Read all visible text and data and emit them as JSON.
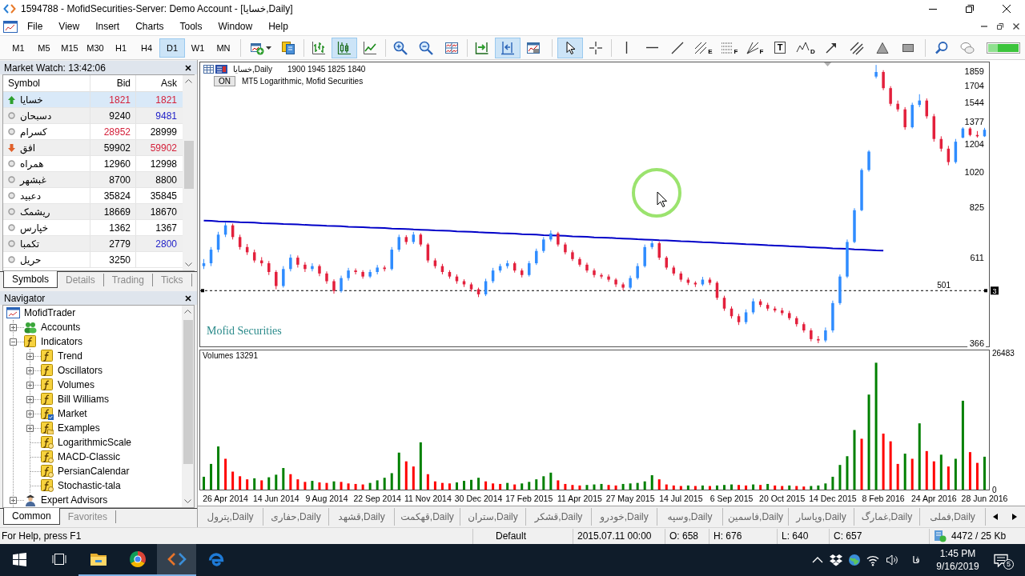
{
  "window": {
    "title": "1594788 - MofidSecurities-Server: Demo Account - [خسایا,Daily]"
  },
  "menu": [
    "File",
    "View",
    "Insert",
    "Charts",
    "Tools",
    "Window",
    "Help"
  ],
  "toolbar": {
    "timeframes": [
      {
        "label": "M1",
        "selected": false
      },
      {
        "label": "M5",
        "selected": false
      },
      {
        "label": "M15",
        "selected": false
      },
      {
        "label": "M30",
        "selected": false
      },
      {
        "label": "H1",
        "selected": false
      },
      {
        "label": "H4",
        "selected": false
      },
      {
        "label": "D1",
        "selected": true
      },
      {
        "label": "W1",
        "selected": false
      },
      {
        "label": "MN",
        "selected": false
      }
    ],
    "tools": [
      {
        "selected": false
      },
      {
        "selected": false
      },
      {
        "selected": false
      },
      {
        "selected": true
      },
      {
        "selected": false
      },
      {
        "selected": false
      },
      {
        "selected": false
      },
      {
        "selected": false
      },
      {
        "selected": false
      },
      {
        "selected": true
      },
      {
        "selected": false
      },
      {
        "selected": true
      },
      {
        "selected": false
      },
      {
        "selected": false
      },
      {
        "selected": false
      },
      {
        "selected": false
      },
      {
        "selected": false,
        "letter": "E"
      },
      {
        "selected": false,
        "letter": "F"
      },
      {
        "selected": false,
        "letter": "F"
      },
      {
        "selected": false,
        "letter": "T"
      },
      {
        "selected": false,
        "letter": "D"
      },
      {
        "selected": false
      },
      {
        "selected": false
      },
      {
        "selected": false
      },
      {
        "selected": false
      },
      {
        "selected": false
      },
      {
        "selected": false
      }
    ]
  },
  "market_watch": {
    "title": "Market Watch: 13:42:06",
    "columns": [
      "Symbol",
      "Bid",
      "Ask"
    ],
    "rows": [
      {
        "symbol": "خسایا",
        "kind": "up",
        "bid": {
          "label": "1821",
          "color": "#d4203a"
        },
        "ask": {
          "label": "1821",
          "color": "#d4203a"
        },
        "selected": true
      },
      {
        "symbol": "دسبحان",
        "kind": "flat",
        "bid": {
          "label": "9240",
          "color": "#000000"
        },
        "ask": {
          "label": "9481",
          "color": "#2323c8"
        },
        "selected": false
      },
      {
        "symbol": "کسرام",
        "kind": "flat",
        "bid": {
          "label": "28952",
          "color": "#d4203a"
        },
        "ask": {
          "label": "28999",
          "color": "#000000"
        },
        "selected": false
      },
      {
        "symbol": "افق",
        "kind": "down",
        "bid": {
          "label": "59902",
          "color": "#000000"
        },
        "ask": {
          "label": "59902",
          "color": "#d4203a"
        },
        "selected": false
      },
      {
        "symbol": "همراه",
        "kind": "flat",
        "bid": {
          "label": "12960",
          "color": "#000000"
        },
        "ask": {
          "label": "12998",
          "color": "#000000"
        },
        "selected": false
      },
      {
        "symbol": "غبشهر",
        "kind": "flat",
        "bid": {
          "label": "8700",
          "color": "#000000"
        },
        "ask": {
          "label": "8800",
          "color": "#000000"
        },
        "selected": false
      },
      {
        "symbol": "دعبید",
        "kind": "flat",
        "bid": {
          "label": "35824",
          "color": "#000000"
        },
        "ask": {
          "label": "35845",
          "color": "#000000"
        },
        "selected": false
      },
      {
        "symbol": "ریشمک",
        "kind": "flat",
        "bid": {
          "label": "18669",
          "color": "#000000"
        },
        "ask": {
          "label": "18670",
          "color": "#000000"
        },
        "selected": false
      },
      {
        "symbol": "خپارس",
        "kind": "flat",
        "bid": {
          "label": "1362",
          "color": "#000000"
        },
        "ask": {
          "label": "1367",
          "color": "#000000"
        },
        "selected": false
      },
      {
        "symbol": "تکمبا",
        "kind": "flat",
        "bid": {
          "label": "2779",
          "color": "#000000"
        },
        "ask": {
          "label": "2800",
          "color": "#2323c8"
        },
        "selected": false
      },
      {
        "symbol": "حریل",
        "kind": "flat",
        "bid": {
          "label": "3250",
          "color": "#000000"
        },
        "selected": false
      }
    ],
    "tabs": [
      {
        "label": "Symbols",
        "selected": true
      },
      {
        "label": "Details",
        "selected": false
      },
      {
        "label": "Trading",
        "selected": false
      },
      {
        "label": "Ticks",
        "selected": false
      }
    ]
  },
  "navigator": {
    "title": "Navigator",
    "tree": [
      {
        "label": "MofidTrader",
        "kind": "root",
        "children": [
          {
            "label": "Accounts",
            "kind": "accounts",
            "expanded": false
          },
          {
            "label": "Indicators",
            "kind": "folder",
            "expanded": true,
            "children": [
              {
                "label": "Trend",
                "kind": "folder",
                "expanded": false
              },
              {
                "label": "Oscillators",
                "kind": "folder",
                "expanded": false
              },
              {
                "label": "Volumes",
                "kind": "folder",
                "expanded": false
              },
              {
                "label": "Bill Williams",
                "kind": "folder",
                "expanded": false
              },
              {
                "label": "Market",
                "kind": "market",
                "expanded": false
              },
              {
                "label": "Examples",
                "kind": "examples",
                "expanded": false
              },
              {
                "label": "LogarithmicScale",
                "kind": "indicator"
              },
              {
                "label": "MACD-Classic",
                "kind": "indicator"
              },
              {
                "label": "PersianCalendar",
                "kind": "indicator"
              },
              {
                "label": "Stochastic-tala",
                "kind": "indicator"
              }
            ]
          },
          {
            "label": "Expert Advisors",
            "kind": "experts",
            "expanded": false
          }
        ]
      }
    ],
    "tabs": [
      {
        "label": "Common",
        "selected": true
      },
      {
        "label": "Favorites",
        "selected": false
      }
    ]
  },
  "chart": {
    "header": {
      "symbol_period": "خسایا,Daily",
      "ohlc": "1900 1945 1825 1840"
    },
    "indicator": {
      "button": "ON",
      "label": "MT5 Logarithmic, Mofid Securities"
    },
    "logo_text": "Mofid Securities",
    "chart_data": [
      {
        "type": "candlestick",
        "log": true,
        "ylim": [
          359,
          1950
        ],
        "yticks": [
          366,
          611,
          825,
          1020,
          1204,
          1377,
          1544,
          1704,
          1859
        ],
        "tick_labels": "y",
        "ohlc": [
          [
            580,
            605,
            570,
            590
          ],
          [
            590,
            650,
            580,
            640
          ],
          [
            640,
            712,
            630,
            700
          ],
          [
            700,
            752,
            690,
            740
          ],
          [
            740,
            748,
            680,
            690
          ],
          [
            690,
            700,
            640,
            650
          ],
          [
            650,
            662,
            620,
            630
          ],
          [
            630,
            640,
            592,
            600
          ],
          [
            600,
            612,
            580,
            590
          ],
          [
            590,
            598,
            550,
            560
          ],
          [
            560,
            566,
            505,
            515
          ],
          [
            515,
            580,
            510,
            570
          ],
          [
            570,
            622,
            562,
            610
          ],
          [
            610,
            618,
            575,
            585
          ],
          [
            585,
            594,
            560,
            570
          ],
          [
            570,
            590,
            562,
            580
          ],
          [
            580,
            586,
            546,
            555
          ],
          [
            555,
            562,
            522,
            530
          ],
          [
            530,
            536,
            492,
            500
          ],
          [
            500,
            548,
            495,
            540
          ],
          [
            540,
            574,
            532,
            565
          ],
          [
            565,
            572,
            552,
            560
          ],
          [
            560,
            566,
            538,
            545
          ],
          [
            545,
            568,
            540,
            560
          ],
          [
            560,
            584,
            552,
            575
          ],
          [
            575,
            582,
            562,
            570
          ],
          [
            570,
            650,
            565,
            640
          ],
          [
            640,
            700,
            632,
            690
          ],
          [
            690,
            698,
            660,
            670
          ],
          [
            670,
            712,
            662,
            700
          ],
          [
            700,
            706,
            652,
            660
          ],
          [
            660,
            666,
            592,
            600
          ],
          [
            600,
            608,
            572,
            580
          ],
          [
            580,
            588,
            552,
            560
          ],
          [
            560,
            566,
            538,
            545
          ],
          [
            545,
            552,
            522,
            530
          ],
          [
            530,
            536,
            512,
            520
          ],
          [
            520,
            526,
            498,
            505
          ],
          [
            505,
            510,
            482,
            490
          ],
          [
            490,
            538,
            485,
            530
          ],
          [
            530,
            574,
            524,
            565
          ],
          [
            565,
            588,
            558,
            580
          ],
          [
            580,
            600,
            572,
            590
          ],
          [
            590,
            596,
            558,
            565
          ],
          [
            565,
            572,
            542,
            550
          ],
          [
            550,
            598,
            545,
            590
          ],
          [
            590,
            644,
            584,
            635
          ],
          [
            635,
            690,
            628,
            680
          ],
          [
            680,
            718,
            672,
            705
          ],
          [
            705,
            712,
            652,
            660
          ],
          [
            660,
            668,
            622,
            630
          ],
          [
            630,
            638,
            598,
            605
          ],
          [
            605,
            612,
            578,
            585
          ],
          [
            585,
            592,
            558,
            565
          ],
          [
            565,
            572,
            542,
            550
          ],
          [
            550,
            556,
            538,
            545
          ],
          [
            545,
            552,
            528,
            535
          ],
          [
            535,
            540,
            512,
            520
          ],
          [
            520,
            526,
            502,
            510
          ],
          [
            510,
            548,
            505,
            540
          ],
          [
            540,
            590,
            535,
            580
          ],
          [
            580,
            660,
            575,
            650
          ],
          [
            650,
            678,
            642,
            665
          ],
          [
            665,
            672,
            602,
            610
          ],
          [
            610,
            616,
            568,
            575
          ],
          [
            575,
            582,
            548,
            555
          ],
          [
            555,
            562,
            528,
            535
          ],
          [
            535,
            542,
            518,
            525
          ],
          [
            525,
            530,
            512,
            520
          ],
          [
            520,
            544,
            515,
            535
          ],
          [
            535,
            542,
            518,
            525
          ],
          [
            525,
            530,
            474,
            480
          ],
          [
            480,
            486,
            444,
            450
          ],
          [
            450,
            456,
            424,
            430
          ],
          [
            430,
            436,
            408,
            415
          ],
          [
            415,
            448,
            410,
            440
          ],
          [
            440,
            478,
            435,
            470
          ],
          [
            470,
            476,
            454,
            460
          ],
          [
            460,
            466,
            444,
            450
          ],
          [
            450,
            456,
            440,
            445
          ],
          [
            445,
            452,
            432,
            438
          ],
          [
            438,
            444,
            420,
            425
          ],
          [
            425,
            430,
            404,
            410
          ],
          [
            410,
            415,
            390,
            395
          ],
          [
            395,
            400,
            370,
            375
          ],
          [
            375,
            382,
            366,
            372
          ],
          [
            372,
            402,
            368,
            395
          ],
          [
            395,
            472,
            390,
            465
          ],
          [
            465,
            552,
            460,
            545
          ],
          [
            545,
            680,
            540,
            670
          ],
          [
            670,
            820,
            665,
            810
          ],
          [
            810,
            1040,
            805,
            1030
          ],
          [
            1030,
            1160,
            1020,
            1150
          ],
          [
            1800,
            1930,
            1780,
            1850
          ],
          [
            1850,
            1870,
            1660,
            1680
          ],
          [
            1680,
            1700,
            1510,
            1530
          ],
          [
            1530,
            1560,
            1460,
            1480
          ],
          [
            1480,
            1500,
            1310,
            1330
          ],
          [
            1330,
            1540,
            1320,
            1520
          ],
          [
            1520,
            1620,
            1500,
            1560
          ],
          [
            1560,
            1580,
            1400,
            1420
          ],
          [
            1420,
            1440,
            1220,
            1240
          ],
          [
            1240,
            1260,
            1150,
            1170
          ],
          [
            1170,
            1190,
            1060,
            1080
          ],
          [
            1080,
            1240,
            1070,
            1220
          ],
          [
            1250,
            1330,
            1245,
            1320
          ],
          [
            1320,
            1330,
            1260,
            1270
          ],
          [
            1270,
            1300,
            1250,
            1260
          ],
          [
            1260,
            1325,
            1255,
            1310
          ]
        ],
        "series": [
          {
            "type": "line",
            "color": "#0000c8",
            "values": [
              761,
              760,
              758,
              757,
              756,
              754,
              753,
              752,
              750,
              749,
              748,
              746,
              745,
              744,
              742,
              741,
              740,
              738,
              737,
              736,
              734,
              733,
              732,
              730,
              729,
              728,
              726,
              725,
              724,
              722,
              721,
              720,
              718,
              717,
              716,
              714,
              713,
              712,
              710,
              709,
              708,
              706,
              705,
              704,
              702,
              701,
              700,
              698,
              697,
              696,
              695,
              693,
              692,
              691,
              689,
              688,
              687,
              685,
              684,
              683,
              681,
              680,
              679,
              677,
              676,
              675,
              673,
              672,
              671,
              669,
              668,
              667,
              665,
              664,
              663,
              661,
              660,
              659,
              657,
              656,
              655,
              653,
              652,
              651,
              649,
              648,
              647,
              645,
              644,
              643,
              641,
              640,
              639,
              637,
              636,
              null,
              null,
              null,
              null,
              null,
              null,
              null,
              null,
              null,
              null,
              null,
              null,
              null,
              null
            ]
          }
        ],
        "ref_lines": [
          {
            "axis": "y",
            "value": 501,
            "label": "501",
            "color": "#000000",
            "line_style": "dashed"
          }
        ],
        "annotations": [
          "3"
        ]
      },
      {
        "type": "bar",
        "title": "Volumes 13291",
        "ylim": [
          0,
          27100
        ],
        "yticks": [
          0,
          26483
        ],
        "categories": [
          null,
          null,
          null,
          "26 Apr 2014",
          null,
          null,
          null,
          null,
          null,
          null,
          "14 Jun 2014",
          null,
          null,
          null,
          null,
          null,
          null,
          "9 Aug 2014",
          null,
          null,
          null,
          null,
          null,
          null,
          "22 Sep 2014",
          null,
          null,
          null,
          null,
          null,
          null,
          "11 Nov 2014",
          null,
          null,
          null,
          null,
          null,
          null,
          "30 Dec 2014",
          null,
          null,
          null,
          null,
          null,
          null,
          "17 Feb 2015",
          null,
          null,
          null,
          null,
          null,
          null,
          "11 Apr 2015",
          null,
          null,
          null,
          null,
          null,
          null,
          "27 May 2015",
          null,
          null,
          null,
          null,
          null,
          null,
          "14 Jul 2015",
          null,
          null,
          null,
          null,
          null,
          null,
          "6 Sep 2015",
          null,
          null,
          null,
          null,
          null,
          null,
          "20 Oct 2015",
          null,
          null,
          null,
          null,
          null,
          null,
          "14 Dec 2015",
          null,
          null,
          null,
          null,
          null,
          null,
          "8 Feb 2016",
          null,
          null,
          null,
          null,
          null,
          null,
          "24 Apr 2016",
          null,
          null,
          null,
          null,
          null,
          null,
          "28 Jun 2016"
        ],
        "values": [
          2500,
          5000,
          8400,
          6000,
          3500,
          2600,
          2000,
          2200,
          1800,
          2400,
          2900,
          4200,
          3000,
          2000,
          1500,
          1700,
          1400,
          1300,
          1600,
          1500,
          1200,
          1100,
          1000,
          1300,
          1800,
          2300,
          3200,
          7200,
          5500,
          4500,
          9200,
          3000,
          1600,
          1300,
          1200,
          1400,
          1700,
          1900,
          2300,
          1600,
          1200,
          1100,
          1300,
          1000,
          1200,
          1500,
          2000,
          2600,
          3300,
          1800,
          1100,
          900,
          800,
          900,
          1000,
          1100,
          900,
          800,
          1100,
          1200,
          1300,
          1600,
          2800,
          2000,
          1000,
          800,
          700,
          800,
          700,
          800,
          700,
          800,
          900,
          1000,
          900,
          800,
          1000,
          900,
          1100,
          800,
          700,
          800,
          700,
          600,
          700,
          800,
          1200,
          2500,
          4800,
          6500,
          11600,
          9900,
          18500,
          24700,
          10900,
          9400,
          5000,
          7000,
          6000,
          12900,
          7500,
          5500,
          6800,
          4500,
          6000,
          17300,
          7300,
          5200,
          6400
        ],
        "colors": [
          "#008000",
          "#008000",
          "#008000",
          "#ff0000",
          "#ff0000",
          "#ff0000",
          "#ff0000",
          "#008000",
          "#ff0000",
          "#008000",
          "#008000",
          "#008000",
          "#ff0000",
          "#ff0000",
          "#ff0000",
          "#008000",
          "#ff0000",
          "#ff0000",
          "#008000",
          "#ff0000",
          "#ff0000",
          "#ff0000",
          "#ff0000",
          "#008000",
          "#008000",
          "#008000",
          "#008000",
          "#008000",
          "#ff0000",
          "#ff0000",
          "#008000",
          "#ff0000",
          "#ff0000",
          "#ff0000",
          "#ff0000",
          "#008000",
          "#008000",
          "#008000",
          "#008000",
          "#ff0000",
          "#ff0000",
          "#ff0000",
          "#008000",
          "#ff0000",
          "#008000",
          "#008000",
          "#008000",
          "#008000",
          "#008000",
          "#ff0000",
          "#ff0000",
          "#ff0000",
          "#ff0000",
          "#008000",
          "#008000",
          "#008000",
          "#ff0000",
          "#ff0000",
          "#008000",
          "#008000",
          "#008000",
          "#008000",
          "#008000",
          "#ff0000",
          "#ff0000",
          "#ff0000",
          "#ff0000",
          "#008000",
          "#ff0000",
          "#008000",
          "#ff0000",
          "#008000",
          "#008000",
          "#008000",
          "#ff0000",
          "#ff0000",
          "#008000",
          "#ff0000",
          "#008000",
          "#ff0000",
          "#ff0000",
          "#008000",
          "#ff0000",
          "#ff0000",
          "#008000",
          "#008000",
          "#008000",
          "#008000",
          "#008000",
          "#008000",
          "#008000",
          "#ff0000",
          "#008000",
          "#008000",
          "#ff0000",
          "#ff0000",
          "#ff0000",
          "#008000",
          "#ff0000",
          "#008000",
          "#ff0000",
          "#ff0000",
          "#008000",
          "#ff0000",
          "#008000",
          "#008000",
          "#ff0000",
          "#ff0000",
          "#008000"
        ]
      }
    ]
  },
  "chart_tabs": [
    {
      "label": "پترول,Daily",
      "selected": false
    },
    {
      "label": "حفاری,Daily",
      "selected": false
    },
    {
      "label": "قشهد,Daily",
      "selected": false
    },
    {
      "label": "قهکمت,Daily",
      "selected": false
    },
    {
      "label": "ستران,Daily",
      "selected": false
    },
    {
      "label": "قشکر,Daily",
      "selected": false
    },
    {
      "label": "خودرو,Daily",
      "selected": false
    },
    {
      "label": "وسپه,Daily",
      "selected": false
    },
    {
      "label": "فاسمین,Daily",
      "selected": false
    },
    {
      "label": "وپاسار,Daily",
      "selected": false
    },
    {
      "label": "غمارگ,Daily",
      "selected": false
    },
    {
      "label": "فملی,Daily",
      "selected": false
    }
  ],
  "status_bar": {
    "help": "For Help, press F1",
    "profile": "Default",
    "time": "2015.07.11 00:00",
    "open": "O: 658",
    "high": "H: 676",
    "low": "L: 640",
    "close": "C: 657",
    "traffic": "4472 / 25 Kb"
  },
  "taskbar": {
    "apps": [
      {
        "running": true,
        "selected": false
      },
      {
        "running": true,
        "selected": false
      },
      {
        "running": true,
        "selected": true
      },
      {
        "running": false,
        "selected": false
      }
    ],
    "language": "فا",
    "time": "1:45 PM",
    "date": "9/16/2019",
    "notifications": "5"
  }
}
